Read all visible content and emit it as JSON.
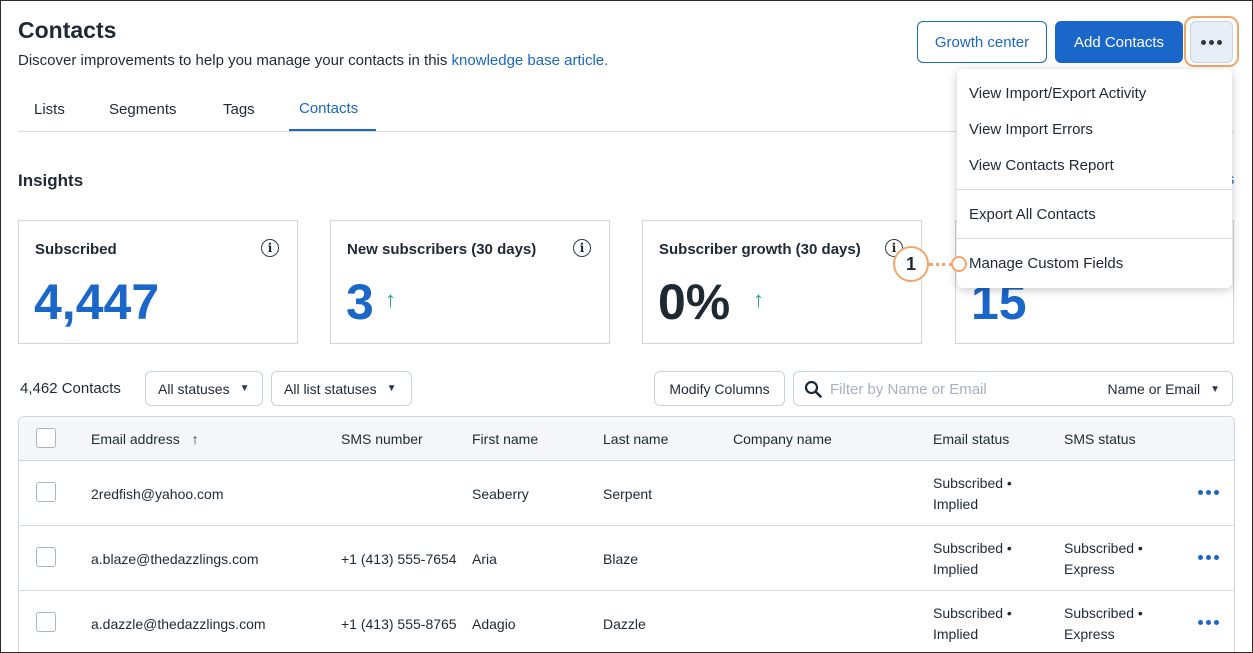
{
  "header": {
    "title": "Contacts",
    "subtitle": "Discover improvements to help you manage your contacts in this ",
    "subtitle_link": "knowledge base article.",
    "growth_button": "Growth center",
    "add_button": "Add Contacts",
    "more_icon": "ellipsis-icon"
  },
  "tabs": [
    {
      "label": "Lists"
    },
    {
      "label": "Segments"
    },
    {
      "label": "Tags"
    },
    {
      "label": "Contacts",
      "active": true
    }
  ],
  "insights": {
    "heading": "Insights",
    "link": "s",
    "cards": [
      {
        "label": "Subscribed",
        "value": "4,447"
      },
      {
        "label": "New subscribers (30 days)",
        "value": "3",
        "trend": "↑"
      },
      {
        "label": "Subscriber growth (30 days)",
        "value": "0%",
        "trend": "↑"
      },
      {
        "label": "",
        "value": "15"
      }
    ],
    "info_icon": "i"
  },
  "menu": {
    "items": [
      "View Import/Export Activity",
      "View Import Errors",
      "View Contacts Report",
      "Export All Contacts",
      "Manage Custom Fields"
    ]
  },
  "callout": {
    "number": "1"
  },
  "filters": {
    "count": "4,462 Contacts",
    "status_select": "All statuses",
    "list_status_select": "All list statuses",
    "modify_columns": "Modify Columns",
    "search_placeholder": "Filter by Name or Email",
    "search_scope": "Name or Email"
  },
  "table": {
    "columns": {
      "email": "Email address",
      "sort_icon": "↑",
      "sms": "SMS number",
      "first": "First name",
      "last": "Last name",
      "company": "Company name",
      "email_status": "Email status",
      "sms_status": "SMS status"
    },
    "rows": [
      {
        "email": "2redfish@yahoo.com",
        "sms": "",
        "first": "Seaberry",
        "last": "Serpent",
        "company": "",
        "email_status_1": "Subscribed •",
        "email_status_2": "Implied",
        "sms_status_1": "",
        "sms_status_2": ""
      },
      {
        "email": "a.blaze@thedazzlings.com",
        "sms": "+1 (413) 555-7654",
        "first": "Aria",
        "last": "Blaze",
        "company": "",
        "email_status_1": "Subscribed •",
        "email_status_2": "Implied",
        "sms_status_1": "Subscribed •",
        "sms_status_2": "Express"
      },
      {
        "email": "a.dazzle@thedazzlings.com",
        "sms": "+1 (413) 555-8765",
        "first": "Adagio",
        "last": "Dazzle",
        "company": "",
        "email_status_1": "Subscribed •",
        "email_status_2": "Implied",
        "sms_status_1": "Subscribed •",
        "sms_status_2": "Express"
      }
    ]
  }
}
